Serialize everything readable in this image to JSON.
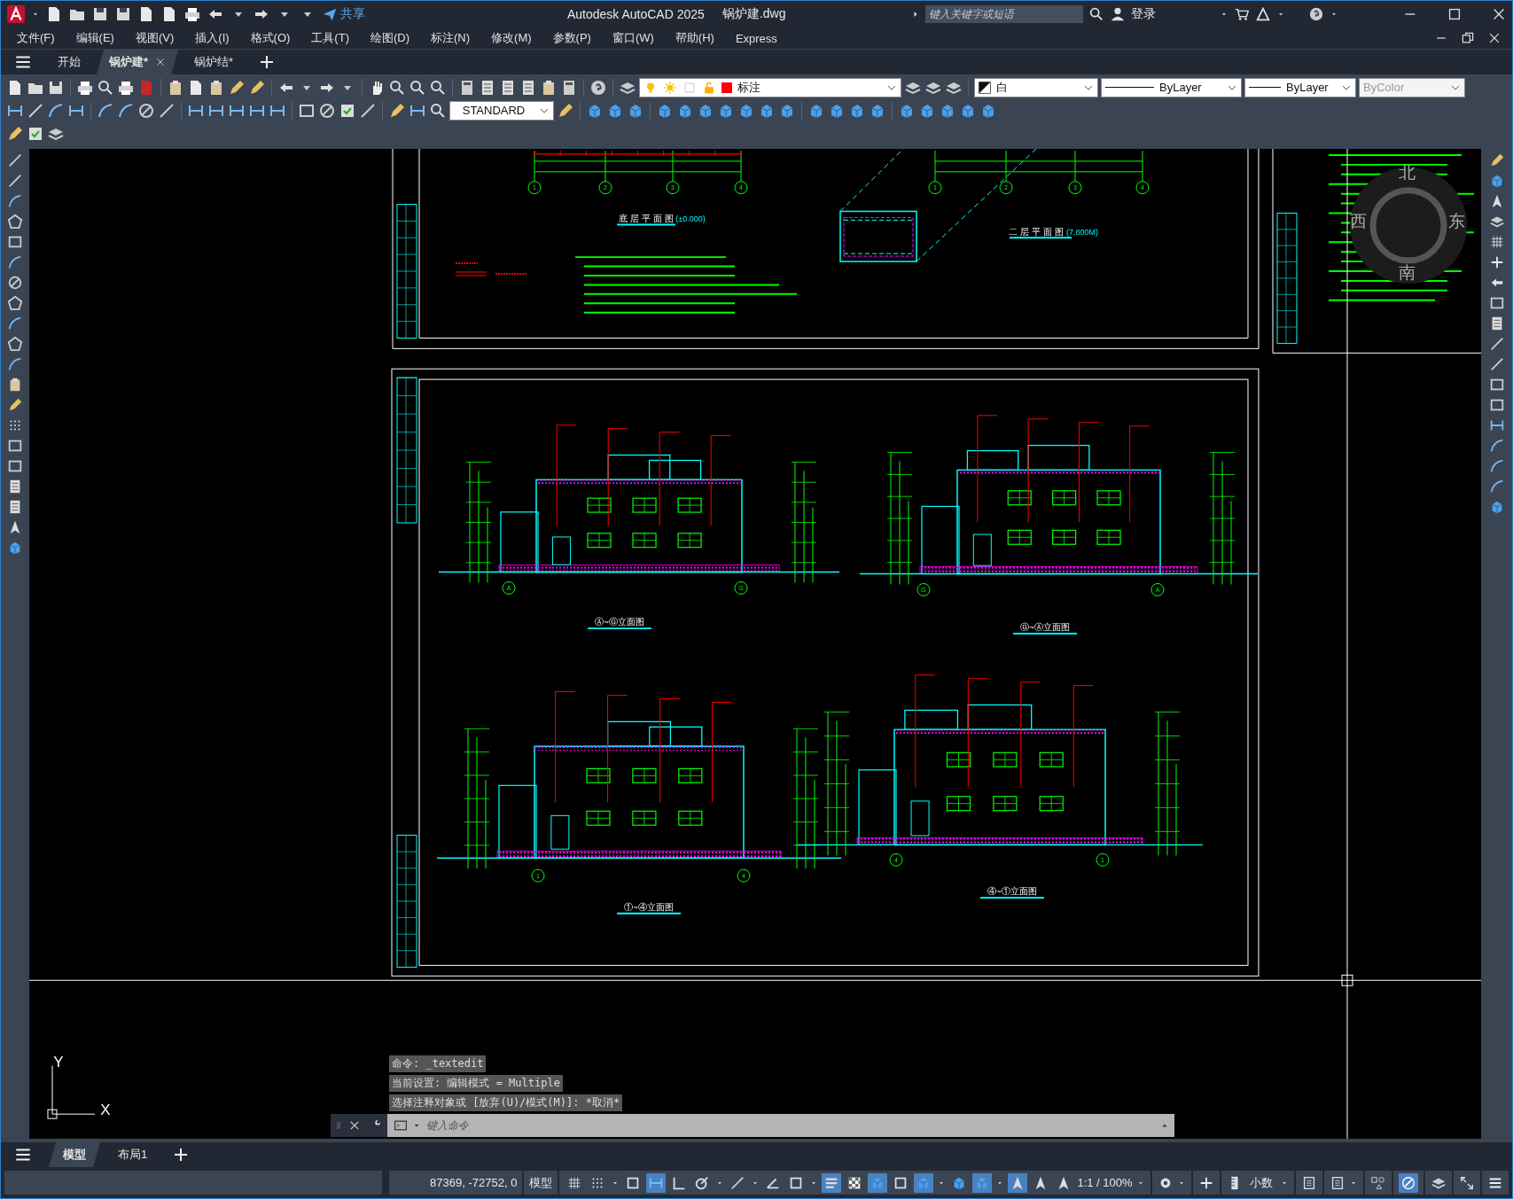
{
  "window": {
    "title": "Autodesk AutoCAD 2025",
    "file": "锅炉建.dwg",
    "share": "共享",
    "search_placeholder": "键入关键字或短语",
    "login": "登录"
  },
  "menu": [
    "文件(F)",
    "编辑(E)",
    "视图(V)",
    "插入(I)",
    "格式(O)",
    "工具(T)",
    "绘图(D)",
    "标注(N)",
    "修改(M)",
    "参数(P)",
    "窗口(W)",
    "帮助(H)",
    "Express"
  ],
  "file_tabs": [
    {
      "label": "开始",
      "selected": false
    },
    {
      "label": "锅炉建*",
      "selected": true
    },
    {
      "label": "锅炉结*",
      "selected": false
    }
  ],
  "properties": {
    "layer": "标注",
    "color_control": "白",
    "linetype": "ByLayer",
    "lineweight": "ByLayer",
    "plot_style": "ByColor"
  },
  "text_style": "STANDARD",
  "drawing": {
    "plans": [
      {
        "title": "底 层 平 面 图",
        "level": "(±0.000)",
        "axes": [
          "1",
          "2",
          "3",
          "4"
        ]
      },
      {
        "title": "二 层 平 面 图",
        "level": "(7.800M)",
        "axes": [
          "1",
          "2",
          "3",
          "4"
        ]
      }
    ],
    "elevations": [
      {
        "title": "Ⓐ~Ⓖ立面图",
        "axes": [
          "A",
          "G"
        ]
      },
      {
        "title": "Ⓖ~Ⓐ立面图",
        "axes": [
          "G",
          "A"
        ]
      },
      {
        "title": "①~④立面图",
        "axes": [
          "1",
          "4"
        ]
      },
      {
        "title": "④~①立面图",
        "axes": [
          "4",
          "1"
        ]
      }
    ],
    "compass": [
      "北",
      "东",
      "南",
      "西"
    ],
    "ucs": {
      "x": "X",
      "y": "Y"
    }
  },
  "command": {
    "history": [
      "命令: _textedit",
      "当前设置: 编辑模式 = Multiple",
      "选择注释对象或 [放弃(U)/模式(M)]: *取消*"
    ],
    "placeholder": "键入命令"
  },
  "layout_tabs": [
    {
      "label": "模型",
      "selected": true
    },
    {
      "label": "布局1",
      "selected": false
    }
  ],
  "status_bar": {
    "coordinates": "87369, -72752, 0",
    "space": "模型",
    "toggles": [
      {
        "on": false
      },
      {
        "on": false
      },
      {
        "on": false
      },
      {
        "on": true
      },
      {
        "on": false
      },
      {
        "on": false
      },
      {
        "on": false
      },
      {
        "on": false
      },
      {
        "on": false
      },
      {
        "on": true
      },
      {
        "on": false
      },
      {
        "on": true
      },
      {
        "on": false
      },
      {
        "on": true
      },
      {
        "on": false
      },
      {
        "on": true
      },
      {
        "on": true
      },
      {
        "on": false
      },
      {
        "on": false
      }
    ],
    "scale": "1:1 / 100%",
    "units": "小数",
    "hardware_acceleration": {
      "on": true
    }
  }
}
